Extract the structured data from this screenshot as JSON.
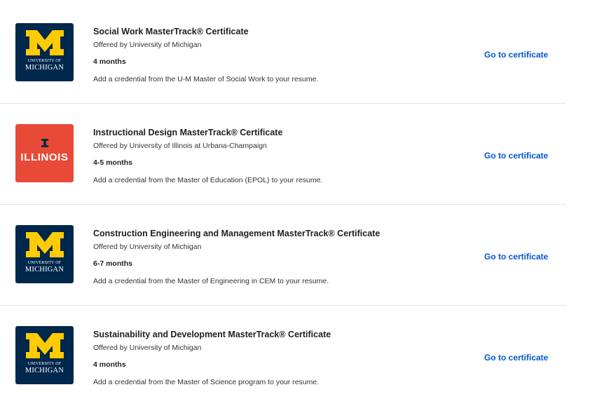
{
  "certificates": [
    {
      "title": "Social Work MasterTrack® Certificate",
      "offered_by": "Offered by University of Michigan",
      "duration": "4 months",
      "description": "Add a credential from the U-M Master of Social Work to your resume.",
      "cta": "Go to certificate",
      "logo": {
        "type": "michigan",
        "line1": "UNIVERSITY OF",
        "line2": "MICHIGAN"
      }
    },
    {
      "title": "Instructional Design MasterTrack® Certificate",
      "offered_by": "Offered by University of Illinois at Urbana-Champaign",
      "duration": "4-5 months",
      "description": "Add a credential from the Master of Education (EPOL) to your resume.",
      "cta": "Go to certificate",
      "logo": {
        "type": "illinois",
        "word": "ILLINOIS"
      }
    },
    {
      "title": "Construction Engineering and Management MasterTrack® Certificate",
      "offered_by": "Offered by University of Michigan",
      "duration": "6-7 months",
      "description": "Add a credential from the Master of Engineering in CEM to your resume.",
      "cta": "Go to certificate",
      "logo": {
        "type": "michigan",
        "line1": "UNIVERSITY OF",
        "line2": "MICHIGAN"
      }
    },
    {
      "title": "Sustainability and Development MasterTrack® Certificate",
      "offered_by": "Offered by University of Michigan",
      "duration": "4 months",
      "description": "Add a credential from the Master of Science program to your resume.",
      "cta": "Go to certificate",
      "logo": {
        "type": "michigan",
        "line1": "UNIVERSITY OF",
        "line2": "MICHIGAN"
      }
    }
  ],
  "colors": {
    "link": "#0056d2",
    "michigan_blue": "#00274c",
    "michigan_maize": "#ffcb05",
    "illinois_orange": "#e84a37",
    "illinois_blue": "#13294b"
  }
}
